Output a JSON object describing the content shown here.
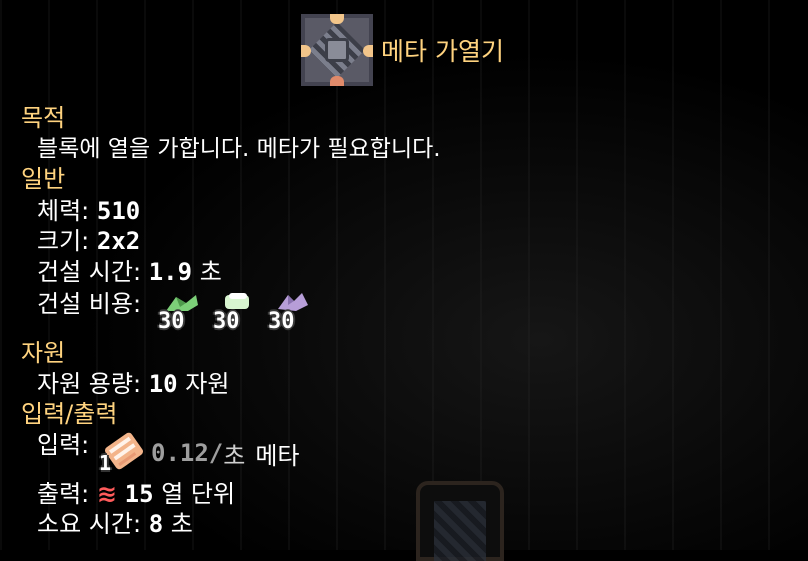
{
  "block": {
    "name": "메타 가열기"
  },
  "sections": {
    "purpose": {
      "title": "목적",
      "description": "블록에 열을 가합니다. 메타가 필요합니다."
    },
    "general": {
      "title": "일반",
      "health_label": "체력:",
      "health_value": "510",
      "size_label": "크기:",
      "size_value": "2x2",
      "build_time_label": "건설 시간:",
      "build_time_value": "1.9",
      "build_time_unit": "초",
      "build_cost_label": "건설 비용:",
      "build_cost": [
        {
          "icon": "lead-icon",
          "amount": "30"
        },
        {
          "icon": "silicon-icon",
          "amount": "30"
        },
        {
          "icon": "phase-fabric-icon",
          "amount": "30"
        }
      ]
    },
    "resources": {
      "title": "자원",
      "capacity_label": "자원 용량:",
      "capacity_value": "10",
      "capacity_unit": "자원"
    },
    "io": {
      "title": "입력/출력",
      "input_label": "입력:",
      "input_item": {
        "icon": "meta-icon",
        "amount": "1",
        "rate": "0.12/",
        "rate_unit": "초",
        "name": "메타"
      },
      "output_label": "출력:",
      "output_icon": "heat-icon",
      "output_icon_glyph": "≋",
      "output_value": "15",
      "output_unit": "열 단위",
      "time_label": "소요 시간:",
      "time_value": "8",
      "time_unit": "초"
    }
  },
  "colors": {
    "section": "#ffd37f",
    "text": "#ffffff",
    "heat": "#ff5b5b",
    "background": "#000000"
  }
}
